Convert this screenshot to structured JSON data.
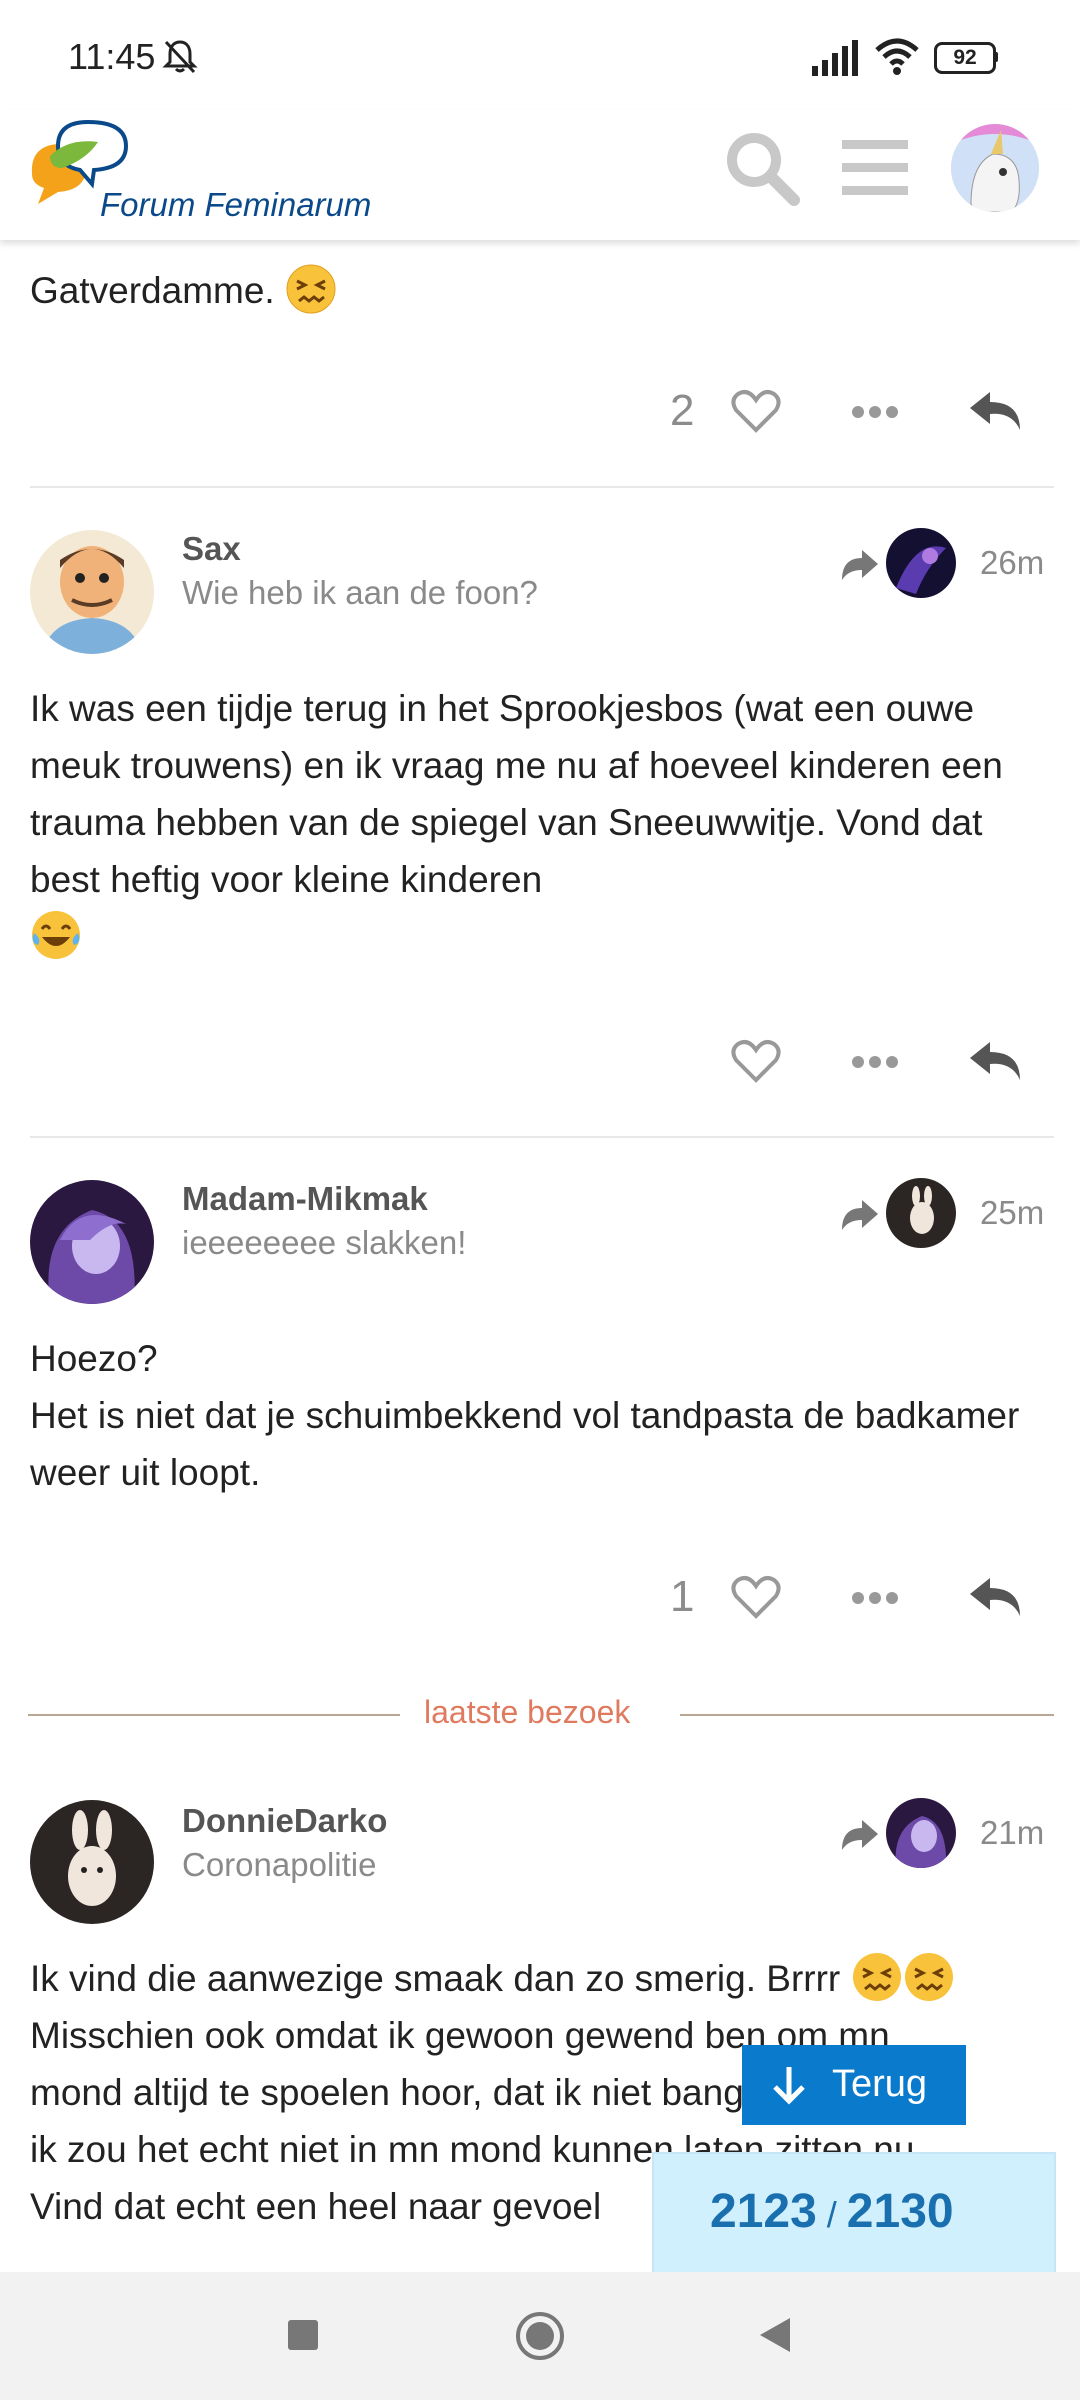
{
  "status_bar": {
    "time": "11:45",
    "battery": "92"
  },
  "header": {
    "logo_text": "Forum Feminarum",
    "search_icon": "search-icon",
    "menu_icon": "hamburger-icon"
  },
  "posts": [
    {
      "text": "Gatverdamme.",
      "emoji": "confounded-face",
      "likes": "2"
    },
    {
      "username": "Sax",
      "user_title": "Wie heb ik aan de foon?",
      "time": "26m",
      "text": "Ik was een tijdje terug in het Sprookjesbos (wat een ouwe meuk trouwens) en ik vraag me nu af hoeveel kinderen een trauma hebben van de spiegel van Sneeuwwitje. Vond dat best heftig voor kleine kinderen",
      "emoji": "tears-of-joy"
    },
    {
      "username": "Madam-Mikmak",
      "user_title": "ieeeeeeee slakken!",
      "time": "25m",
      "line1": "Hoezo?",
      "line2": "Het is niet dat je schuimbekkend vol tandpasta de badkamer weer uit loopt.",
      "likes": "1"
    },
    {
      "username": "DonnieDarko",
      "user_title": "Coronapolitie",
      "time": "21m",
      "line1": "Ik vind die aanwezige smaak dan zo smerig. Brrrr",
      "line2": "Misschien ook omdat ik gewoon gewend ben om mn",
      "line3": "mond altijd te spoelen hoor, dat ik niet bang ben maar",
      "line4": "ik zou het echt niet in mn mond kunnen laten zitten nu.",
      "line5": "Vind dat echt een heel naar gevoel"
    }
  ],
  "last_visit_label": "laatste bezoek",
  "terug_button": "Terug",
  "progress": {
    "current": "2123",
    "separator": "/",
    "total": "2130"
  },
  "colors": {
    "accent": "#0a7bcc",
    "progress_bg": "#d1f0fd",
    "last_visit": "#e07a5f"
  }
}
